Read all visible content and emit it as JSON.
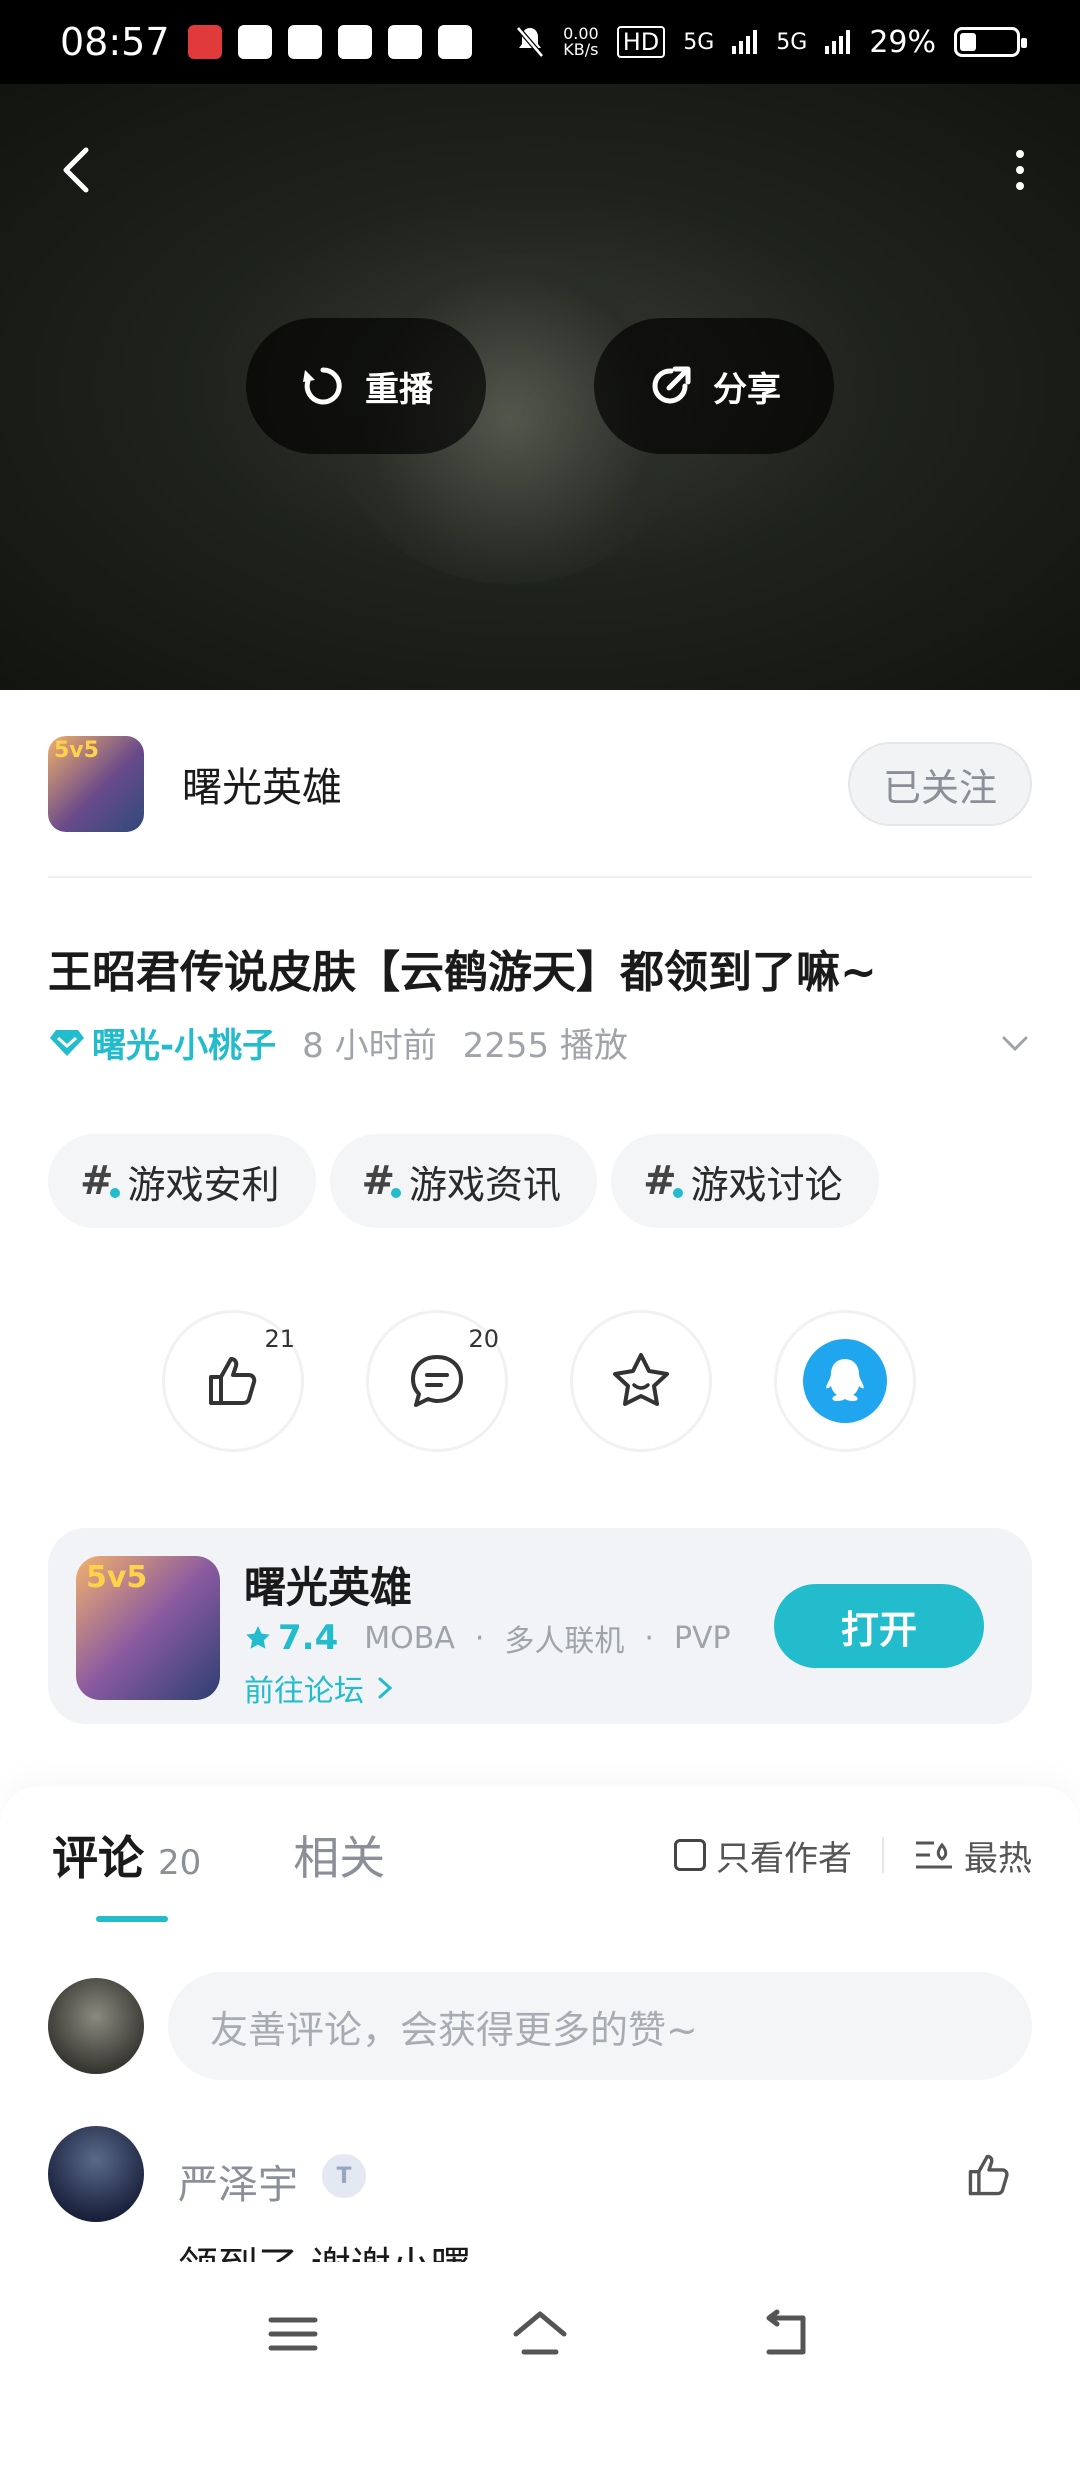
{
  "status_bar": {
    "time": "08:57",
    "net_speed_value": "0.00",
    "net_speed_unit": "KB/s",
    "hd": "HD",
    "signal1": "5G",
    "signal2": "5G",
    "battery_percent": "29%",
    "battery_level": 0.29
  },
  "video": {
    "replay_label": "重播",
    "share_label": "分享"
  },
  "publisher": {
    "logo_text": "5v5",
    "name": "曙光英雄",
    "follow_label": "已关注"
  },
  "post": {
    "title": "王昭君传说皮肤【云鹤游天】都领到了嘛~",
    "author": "曙光-小桃子",
    "time_ago": "8 小时前",
    "plays": "2255 播放",
    "tags": [
      "游戏安利",
      "游戏资讯",
      "游戏讨论"
    ]
  },
  "actions": {
    "like_count": "21",
    "comment_count": "20"
  },
  "game_card": {
    "icon_text": "5v5",
    "name": "曙光英雄",
    "rating": "7.4",
    "genre1": "MOBA",
    "genre2": "多人联机",
    "genre3": "PVP",
    "dot": "·",
    "forum_link": "前往论坛",
    "open_label": "打开"
  },
  "comments": {
    "tab_comments": "评论",
    "comments_count": "20",
    "tab_related": "相关",
    "only_author": "只看作者",
    "sort": "最热",
    "input_placeholder": "友善评论，会获得更多的赞~",
    "items": [
      {
        "user": "严泽宇",
        "badge": "T",
        "text": "领到了 谢谢小曙"
      }
    ]
  },
  "colors": {
    "accent": "#22bccc",
    "qq_blue": "#20a6ef"
  }
}
